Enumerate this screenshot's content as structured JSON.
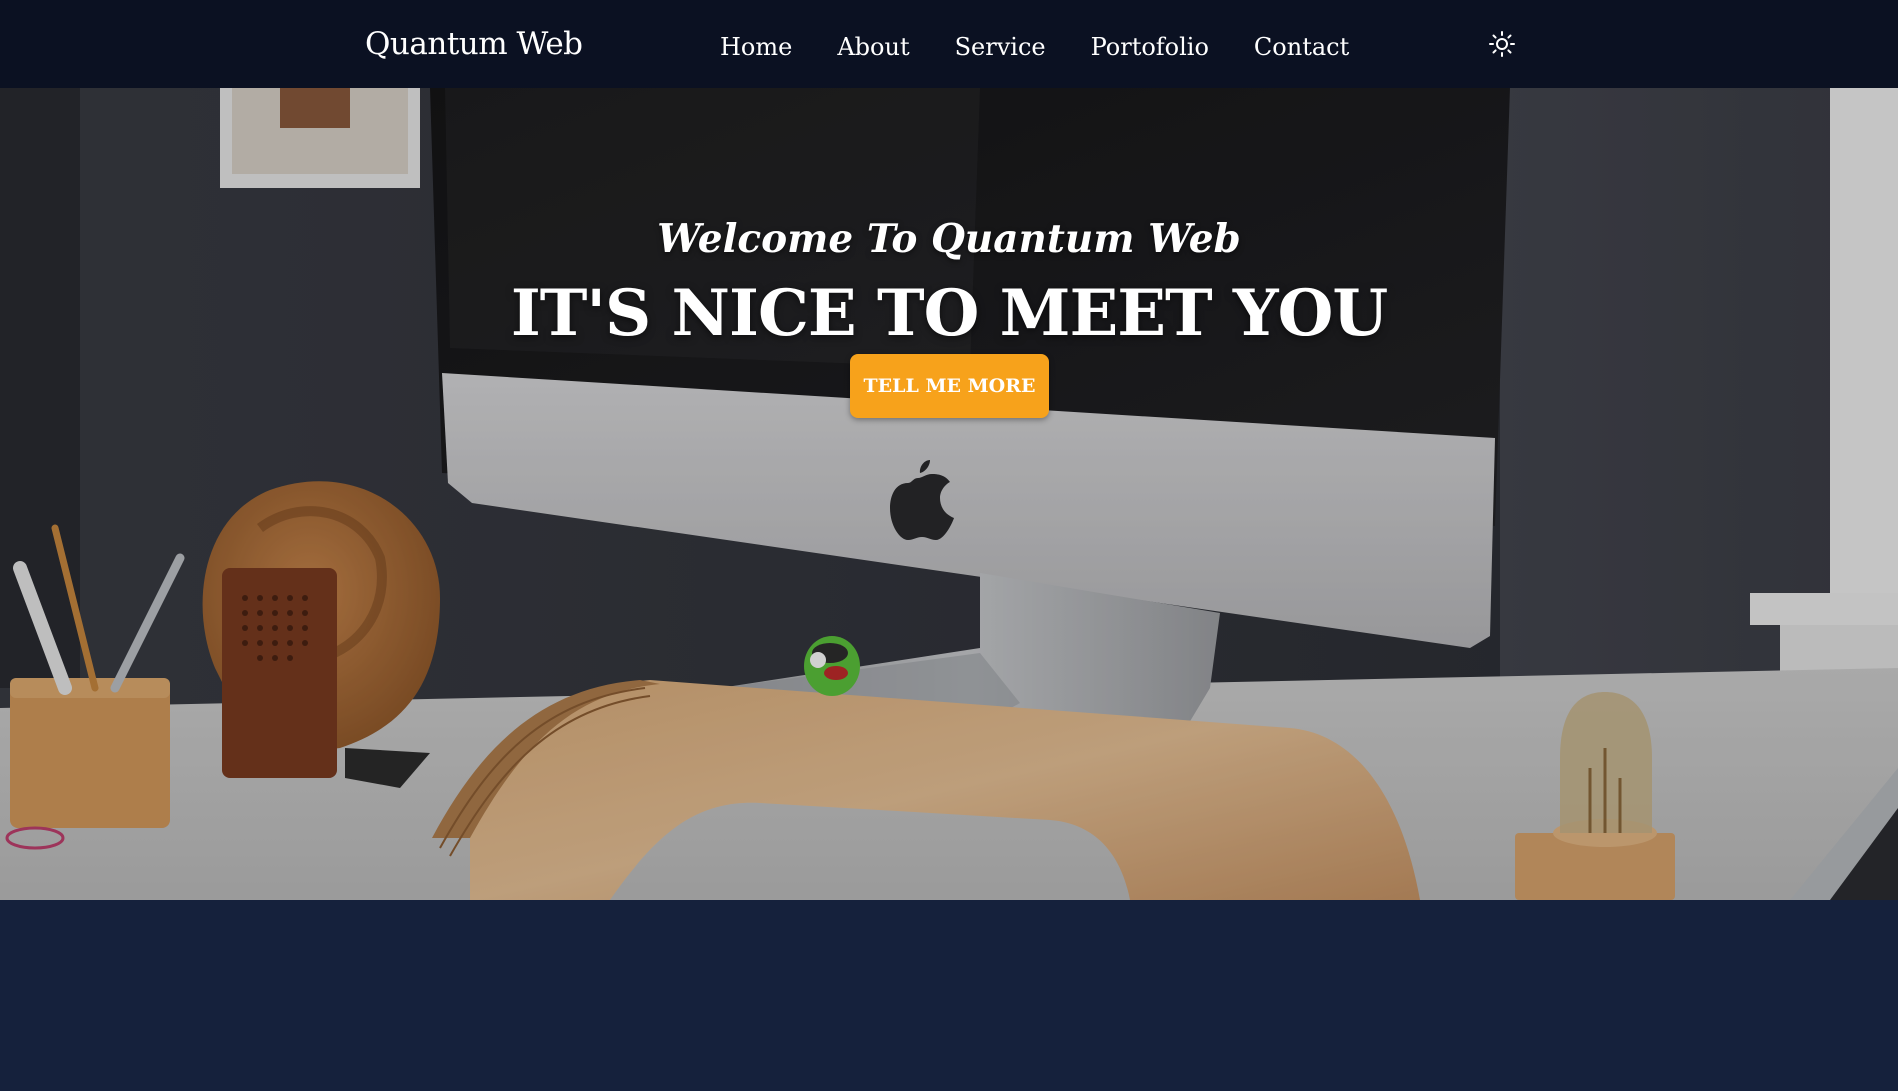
{
  "navbar": {
    "brand": "Quantum Web",
    "links": [
      {
        "label": "Home"
      },
      {
        "label": "About"
      },
      {
        "label": "Service"
      },
      {
        "label": "Portofolio"
      },
      {
        "label": "Contact"
      }
    ],
    "theme_icon": "sun-icon"
  },
  "hero": {
    "subtitle": "Welcome To Quantum Web",
    "title": "IT'S NICE TO MEET YOU",
    "button_label": "TELL ME MORE",
    "background_image": "desk-with-imac-photo"
  },
  "colors": {
    "navbar_bg": "#0b1122",
    "page_bg": "#15213c",
    "accent": "#f7a21b",
    "text": "#ffffff"
  }
}
